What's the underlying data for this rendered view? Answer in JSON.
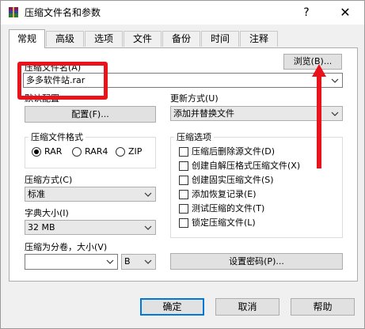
{
  "window": {
    "title": "压缩文件名和参数",
    "help_glyph": "?",
    "close_glyph": "✕"
  },
  "tabs": [
    {
      "label": "常规"
    },
    {
      "label": "高级"
    },
    {
      "label": "选项"
    },
    {
      "label": "文件"
    },
    {
      "label": "备份"
    },
    {
      "label": "时间"
    },
    {
      "label": "注释"
    }
  ],
  "archive": {
    "name_label": "压缩文件名(A)",
    "name_value": "多多软件站.rar",
    "browse_label": "浏览(B)..."
  },
  "profile": {
    "label": "默认配置",
    "button_label": "配置(F)..."
  },
  "update_mode": {
    "label": "更新方式(U)",
    "value": "添加并替换文件"
  },
  "format": {
    "group_label": "压缩文件格式",
    "options": [
      {
        "label": "RAR",
        "checked": true
      },
      {
        "label": "RAR4",
        "checked": false
      },
      {
        "label": "ZIP",
        "checked": false
      }
    ]
  },
  "method": {
    "label": "压缩方式(C)",
    "value": "标准"
  },
  "dictionary": {
    "label": "字典大小(I)",
    "value": "32 MB"
  },
  "split": {
    "label": "压缩为分卷，大小(V)",
    "value": "",
    "unit": "B"
  },
  "options_group": {
    "label": "压缩选项",
    "items": [
      {
        "label": "压缩后删除源文件(D)",
        "checked": false
      },
      {
        "label": "创建自解压格式压缩文件(X)",
        "checked": false
      },
      {
        "label": "创建固实压缩文件(S)",
        "checked": false
      },
      {
        "label": "添加恢复记录(E)",
        "checked": false
      },
      {
        "label": "测试压缩的文件(T)",
        "checked": false
      },
      {
        "label": "锁定压缩文件(L)",
        "checked": false
      }
    ]
  },
  "password_button": "设置密码(P)...",
  "footer": {
    "ok": "确定",
    "cancel": "取消",
    "help": "帮助"
  },
  "colors": {
    "annotation_red": "#e8131b",
    "accent": "#0078d7"
  }
}
